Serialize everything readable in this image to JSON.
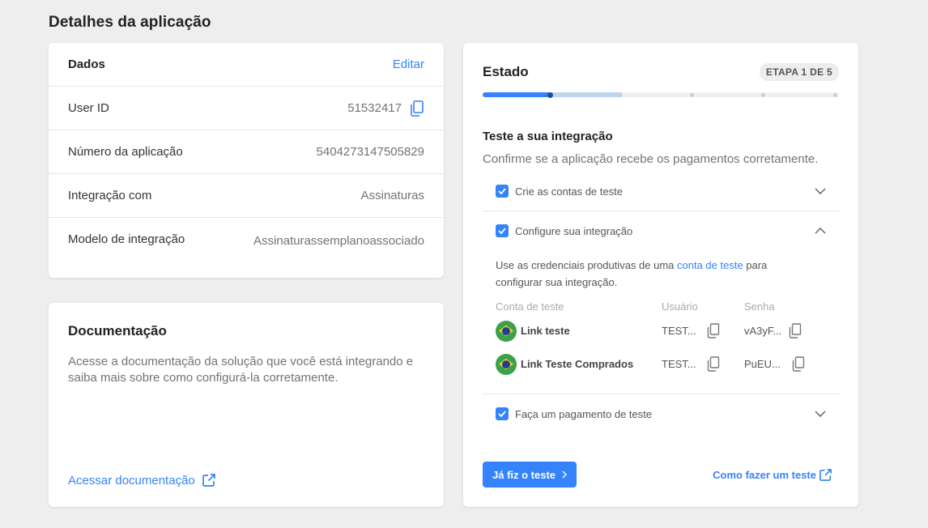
{
  "page": {
    "title": "Detalhes da aplicação"
  },
  "details": {
    "header_label": "Dados",
    "edit_label": "Editar",
    "rows": [
      {
        "label": "User ID",
        "value": "51532417"
      },
      {
        "label": "Número da aplicação",
        "value": "5404273147505829"
      },
      {
        "label": "Integração com",
        "value": "Assinaturas"
      },
      {
        "label": "Modelo de integração",
        "value": "Assinaturassemplanoassociado"
      }
    ]
  },
  "documentation": {
    "title": "Documentação",
    "description": "Acesse a documentação da solução que você está integrando e saiba mais sobre como configurá-la corretamente.",
    "link_label": "Acessar documentação"
  },
  "status": {
    "title": "Estado",
    "step_badge": "ETAPA 1 DE 5",
    "progress": {
      "current_step": 1,
      "total_steps": 5
    },
    "section_title": "Teste a sua integração",
    "section_description": "Confirme se a aplicação recebe os pagamentos corretamente.",
    "accordion": [
      {
        "label": "Crie as contas de teste",
        "checked": true,
        "expanded": false
      },
      {
        "label": "Configure sua integração",
        "checked": true,
        "expanded": true
      },
      {
        "label": "Faça um pagamento de teste",
        "checked": true,
        "expanded": false
      }
    ],
    "config": {
      "text_before": "Use as credenciais produtivas de uma ",
      "text_link": "conta de teste",
      "text_after": " para configurar sua integração.",
      "columns": [
        "Conta de teste",
        "Usuário",
        "Senha"
      ],
      "accounts": [
        {
          "name": "Link teste",
          "user": "TEST...",
          "password": "vA3yF..."
        },
        {
          "name": "Link Teste Comprados",
          "user": "TEST...",
          "password": "PuEU..."
        }
      ]
    },
    "done_button": "Já fiz o teste",
    "how_link": "Como fazer um teste"
  },
  "colors": {
    "accent": "#3483fa",
    "background": "#eeeeee"
  }
}
